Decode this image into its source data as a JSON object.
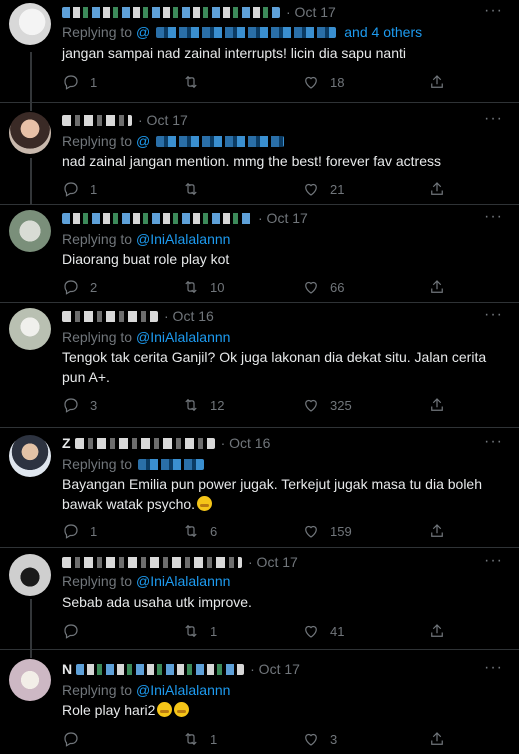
{
  "labels": {
    "replying_to": "Replying to"
  },
  "tweets": [
    {
      "date": "· Oct 17",
      "handle": "@",
      "extra": "and 4 others",
      "text": "jangan sampai nad zainal interrupts! licin dia sapu nanti",
      "replies": "1",
      "retweets": "",
      "likes": "18"
    },
    {
      "date": "· Oct 17",
      "handle": "@",
      "text": "nad zainal jangan mention. mmg the best! forever fav actress",
      "replies": "1",
      "retweets": "",
      "likes": "21"
    },
    {
      "date": "· Oct 17",
      "handle": "@IniAlalalannn",
      "text": "Diaorang buat role play kot",
      "replies": "2",
      "retweets": "10",
      "likes": "66"
    },
    {
      "date": "· Oct 16",
      "handle": "@IniAlalalannn",
      "text": "Tengok tak cerita Ganjil? Ok juga lakonan dia dekat situ. Jalan cerita pun A+.",
      "replies": "3",
      "retweets": "12",
      "likes": "325"
    },
    {
      "name_char": "Z",
      "date": "· Oct 16",
      "handle": "",
      "text": "Bayangan Emilia pun power jugak. Terkejut jugak masa tu dia boleh bawak watak psycho.",
      "replies": "1",
      "retweets": "6",
      "likes": "159"
    },
    {
      "date": "· Oct 17",
      "handle": "@IniAlalalannn",
      "text": "Sebab ada usaha utk improve.",
      "replies": "",
      "retweets": "1",
      "likes": "41"
    },
    {
      "name_char": "N",
      "date": "· Oct 17",
      "handle": "@IniAlalalannn",
      "text": "Role play hari2",
      "replies": "",
      "retweets": "1",
      "likes": "3"
    }
  ],
  "icons": {
    "reply": "reply-icon",
    "retweet": "retweet-icon",
    "like": "like-icon",
    "share": "share-icon",
    "more": "more-icon"
  },
  "colors": {
    "background": "#000000",
    "text": "#e7e9ea",
    "secondary": "#71767b",
    "accent": "#1d9bf0",
    "divider": "#2f3336"
  }
}
